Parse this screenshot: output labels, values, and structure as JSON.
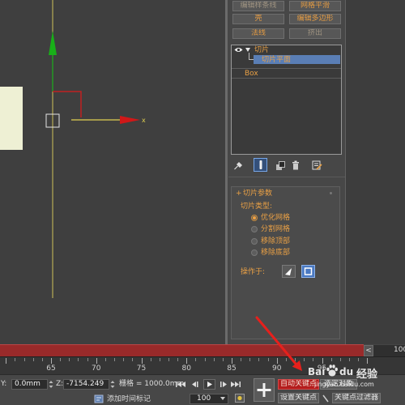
{
  "viewport": {
    "gizmo_axis_label": "x"
  },
  "modifier_buttons": [
    {
      "label": "编辑样条线",
      "dim": true
    },
    {
      "label": "网格平滑",
      "dim": false
    },
    {
      "label": "壳",
      "dim": false
    },
    {
      "label": "编辑多边形",
      "dim": false
    },
    {
      "label": "法线",
      "dim": false
    },
    {
      "label": "挤出",
      "dim": true
    }
  ],
  "modifier_stack": {
    "items": [
      {
        "label": "切片",
        "icon": "eye-icon",
        "expanded": true
      },
      {
        "label": "切片平面",
        "selected": true
      },
      {
        "label": "Box"
      }
    ]
  },
  "stack_toolbar": {
    "icons": [
      "pin-stack-icon",
      "show-end-result-icon",
      "make-unique-icon",
      "remove-modifier-icon",
      "configure-modifier-sets-icon"
    ],
    "active": "show-end-result-icon"
  },
  "rollout": {
    "toggle": "+",
    "title": "切片参数",
    "slice_type_label": "切片类型:",
    "options": [
      {
        "label": "优化网格",
        "checked": true
      },
      {
        "label": "分割网格",
        "checked": false
      },
      {
        "label": "移除顶部",
        "checked": false
      },
      {
        "label": "移除底部",
        "checked": false
      }
    ],
    "operate_on_label": "操作于:",
    "operate_on_buttons": [
      {
        "icon": "face-mode-icon",
        "active": false
      },
      {
        "icon": "polygon-mode-icon",
        "active": true
      }
    ]
  },
  "timeline": {
    "prev_button": "<",
    "end_frame": "100",
    "tick_labels": [
      "65",
      "70",
      "75",
      "80",
      "85",
      "90",
      "95"
    ]
  },
  "status_bar": {
    "y_label": "Y:",
    "y_value": "0.0mm",
    "z_label": "Z:",
    "z_value": "-7154.249",
    "grid": "栅格 = 1000.0mm",
    "add_time_tag": "添加时间标记",
    "current_frame": "100",
    "auto_key": "自动关键点",
    "selection_set": "选定对象",
    "set_key": "设置关键点",
    "key_filters": "关键点过滤器",
    "playback": [
      "go-to-start-icon",
      "previous-frame-icon",
      "play-icon",
      "next-frame-icon",
      "go-to-end-icon"
    ]
  },
  "watermark": {
    "brand_left": "Bai",
    "brand_right": "du",
    "label": "经验",
    "url": "jingyan.baidu.com"
  },
  "colors": {
    "accent_orange": "#e8a045",
    "auto_key_red": "#b41d1d",
    "selection_blue": "#5a7eb5",
    "time_slider_red": "#992a2a",
    "gizmo_x": "#d01818",
    "gizmo_y": "#18b018",
    "gizmo_selected": "#e0d050",
    "box_object": "#eef0d4",
    "annotation_arrow": "#e6201c"
  }
}
